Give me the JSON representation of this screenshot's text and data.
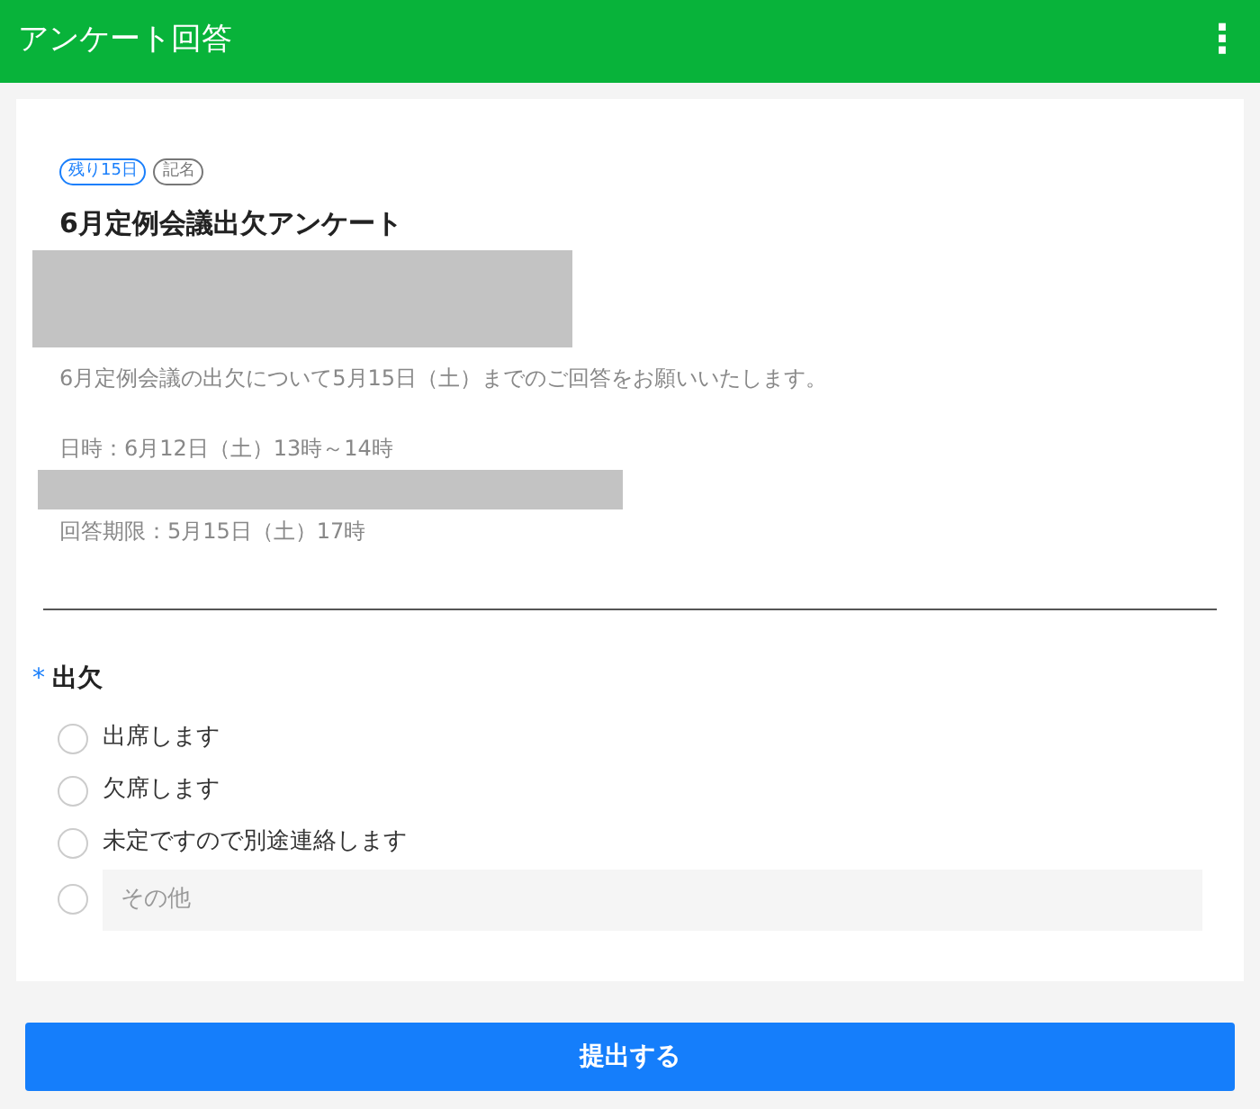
{
  "header": {
    "title": "アンケート回答",
    "menu": "⋮"
  },
  "survey": {
    "tags": [
      {
        "label": "残り15日",
        "color": "#1a7ffb"
      },
      {
        "label": "記名",
        "color": "#777777"
      }
    ],
    "title": "6月定例会議出欠アンケート",
    "description": [
      {
        "kind": "redacted"
      },
      {
        "kind": "text",
        "text": "6月定例会議の出欠について5月15日（土）までのご回答をお願いいたします。"
      },
      {
        "kind": "gap"
      },
      {
        "kind": "text",
        "text": "日時：6月12日（土）13時～14時"
      },
      {
        "kind": "redacted"
      },
      {
        "kind": "text",
        "text": "回答期限：5月15日（土）17時"
      }
    ]
  },
  "question": {
    "required_mark": "*",
    "label": "出欠",
    "options": [
      {
        "kind": "choice",
        "label": "出席します",
        "selected": false
      },
      {
        "kind": "choice",
        "label": "欠席します",
        "selected": false
      },
      {
        "kind": "choice",
        "label": "未定ですので別途連絡します",
        "selected": false
      },
      {
        "kind": "other",
        "placeholder": "その他",
        "selected": false
      }
    ]
  },
  "submit_button": "提出する"
}
